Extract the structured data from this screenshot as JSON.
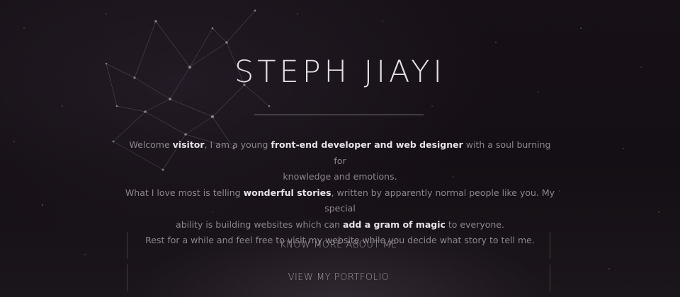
{
  "hero": {
    "title": "STEPH JIAYI",
    "intro": {
      "line1": {
        "a": "Welcome ",
        "b": "visitor",
        "c": ", I am a young ",
        "d": "front-end developer and web designer",
        "e": " with a soul burning for"
      },
      "line2": "knowledge and emotions.",
      "line3": {
        "a": "What I love most is telling ",
        "b": "wonderful stories",
        "c": ", written by apparently normal people like you. My special"
      },
      "line4": {
        "a": "ability is building websites which can ",
        "b": "add a gram of magic",
        "c": " to everyone."
      },
      "line5": "Rest for a while and feel free to visit my website while you decide what story to tell me."
    }
  },
  "actions": {
    "about_label": "KNOW MORE ABOUT ME",
    "portfolio_label": "VIEW MY PORTFOLIO"
  },
  "background": {
    "decoration": "constellation-network"
  },
  "colors": {
    "background": "#151015",
    "title": "#e3e0e4",
    "text": "#8c878d",
    "emphasis": "#e6e3e7",
    "cta_text": "#9e999f",
    "cta_border": "#4a3d2f"
  }
}
